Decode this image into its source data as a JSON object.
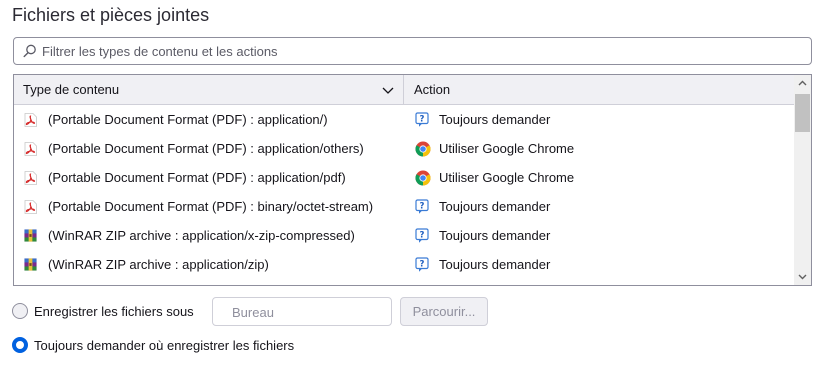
{
  "section": {
    "title": "Fichiers et pièces jointes"
  },
  "search": {
    "placeholder": "Filtrer les types de contenu et les actions"
  },
  "table": {
    "headers": {
      "type": "Type de contenu",
      "action": "Action"
    },
    "rows": [
      {
        "type": "(Portable Document Format (PDF) : application/)",
        "type_icon": "pdf-icon",
        "action": "Toujours demander",
        "action_icon": "ask-icon"
      },
      {
        "type": "(Portable Document Format (PDF) : application/others)",
        "type_icon": "pdf-icon",
        "action": "Utiliser Google Chrome",
        "action_icon": "chrome-icon"
      },
      {
        "type": "(Portable Document Format (PDF) : application/pdf)",
        "type_icon": "pdf-icon",
        "action": "Utiliser Google Chrome",
        "action_icon": "chrome-icon"
      },
      {
        "type": "(Portable Document Format (PDF) : binary/octet-stream)",
        "type_icon": "pdf-icon",
        "action": "Toujours demander",
        "action_icon": "ask-icon"
      },
      {
        "type": "(WinRAR ZIP archive : application/x-zip-compressed)",
        "type_icon": "winrar-icon",
        "action": "Toujours demander",
        "action_icon": "ask-icon"
      },
      {
        "type": "(WinRAR ZIP archive : application/zip)",
        "type_icon": "winrar-icon",
        "action": "Toujours demander",
        "action_icon": "ask-icon"
      }
    ]
  },
  "downloads": {
    "save_to_label": "Enregistrer les fichiers sous",
    "folder_value": "Bureau",
    "browse_label": "Parcourir...",
    "always_ask_label": "Toujours demander où enregistrer les fichiers",
    "selected": "always_ask"
  },
  "colors": {
    "accent": "#0061e0",
    "border": "#8f8f9d",
    "header_bg": "#f0f0f4",
    "pdf_red": "#d62828"
  }
}
